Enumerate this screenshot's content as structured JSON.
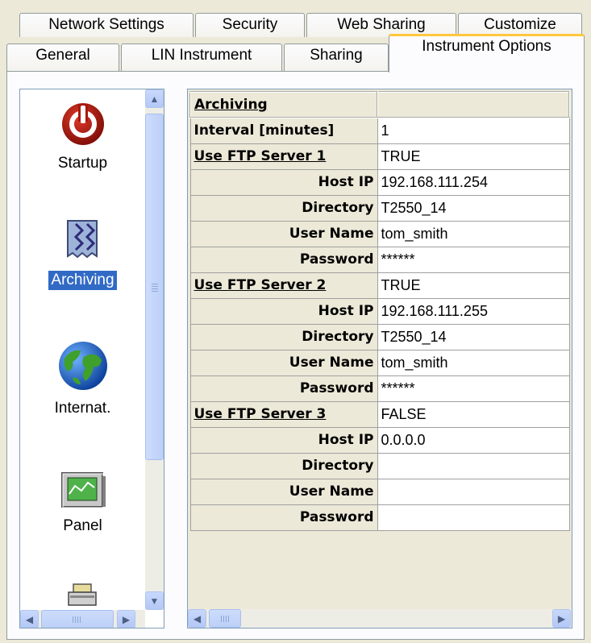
{
  "tabs_row1": [
    {
      "label": "Network Settings"
    },
    {
      "label": "Security"
    },
    {
      "label": "Web Sharing"
    },
    {
      "label": "Customize"
    }
  ],
  "tabs_row2": [
    {
      "label": "General"
    },
    {
      "label": "LIN Instrument"
    },
    {
      "label": "Sharing"
    },
    {
      "label": "Instrument Options",
      "active": true
    }
  ],
  "categories": [
    {
      "label": "Startup",
      "icon": "power-icon"
    },
    {
      "label": "Archiving",
      "icon": "archive-icon",
      "selected": true
    },
    {
      "label": "Internat.",
      "icon": "globe-icon"
    },
    {
      "label": "Panel",
      "icon": "panel-icon"
    },
    {
      "label": "",
      "icon": "printer-icon"
    }
  ],
  "grid": {
    "header": {
      "label": "Archiving",
      "value": ""
    },
    "rows": [
      {
        "label": "Interval [minutes]",
        "value": "1",
        "kind": "plain"
      },
      {
        "label": "Use FTP Server 1",
        "value": "TRUE",
        "kind": "hdr"
      },
      {
        "label": "Host IP",
        "value": "192.168.111.254",
        "kind": "sub"
      },
      {
        "label": "Directory",
        "value": "T2550_14",
        "kind": "sub"
      },
      {
        "label": "User Name",
        "value": "tom_smith",
        "kind": "sub"
      },
      {
        "label": "Password",
        "value": "******",
        "kind": "sub"
      },
      {
        "label": "Use FTP Server 2",
        "value": "TRUE",
        "kind": "hdr"
      },
      {
        "label": "Host IP",
        "value": "192.168.111.255",
        "kind": "sub"
      },
      {
        "label": "Directory",
        "value": "T2550_14",
        "kind": "sub"
      },
      {
        "label": "User Name",
        "value": "tom_smith",
        "kind": "sub"
      },
      {
        "label": "Password",
        "value": "******",
        "kind": "sub"
      },
      {
        "label": "Use FTP Server 3",
        "value": "FALSE",
        "kind": "hdr"
      },
      {
        "label": "Host IP",
        "value": "0.0.0.0",
        "kind": "sub"
      },
      {
        "label": "Directory",
        "value": "",
        "kind": "sub"
      },
      {
        "label": "User Name",
        "value": "",
        "kind": "sub"
      },
      {
        "label": "Password",
        "value": "",
        "kind": "sub"
      }
    ]
  },
  "colors": {
    "selection": "#316ac5",
    "active_tab_accent": "#ffc83c",
    "scrollbar": "#c9d8fc"
  }
}
